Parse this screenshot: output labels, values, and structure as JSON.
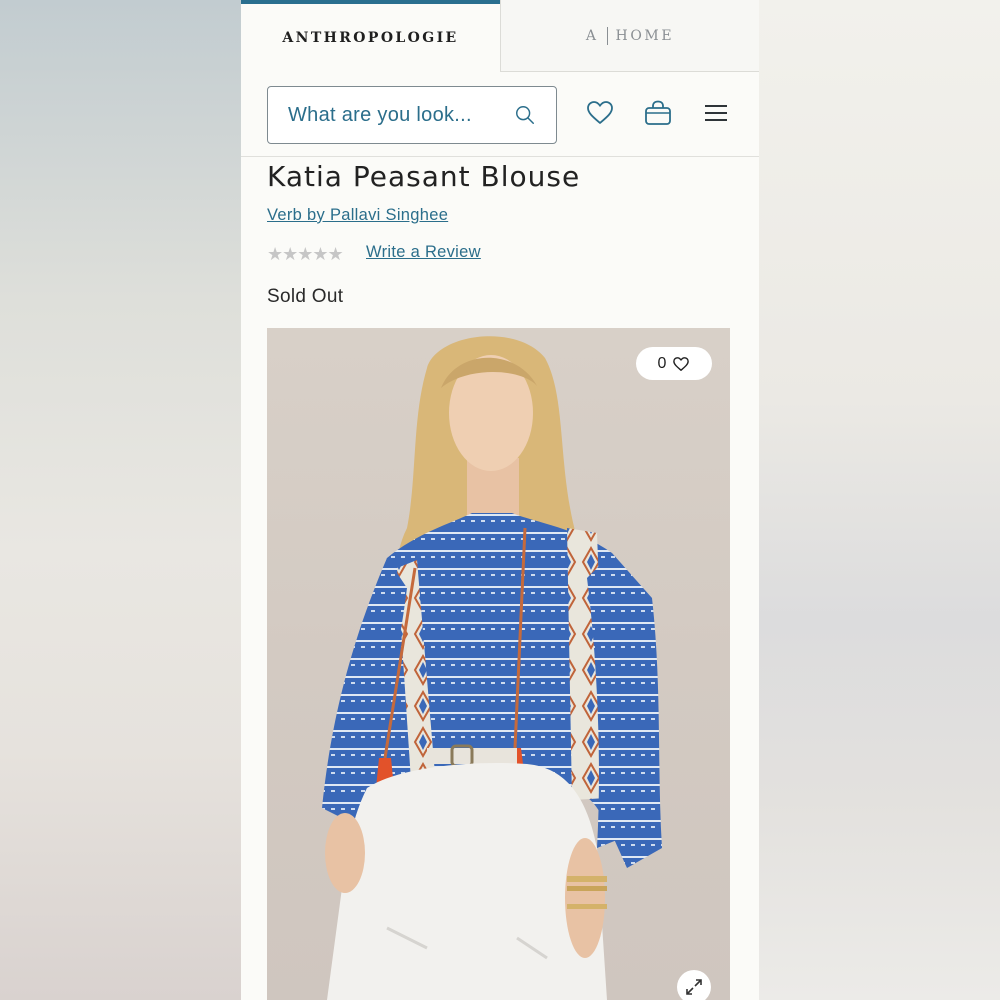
{
  "tabs": {
    "primary": "ANTHROPOLOGIE",
    "secondary_a": "A",
    "secondary_home": "HOME"
  },
  "header": {
    "search_placeholder": "What are you look...",
    "icons": [
      "heart-icon",
      "bag-icon",
      "menu-icon"
    ]
  },
  "product": {
    "title": "Katia Peasant Blouse",
    "brand": "Verb by Pallavi Singhee",
    "rating_stars": "★★★★★",
    "rating_value": 0,
    "review_link": "Write a Review",
    "availability": "Sold Out",
    "like_count": "0"
  },
  "colors": {
    "accent": "#2b6e8b",
    "tab_border": "#2a6f8f",
    "star_empty": "#c6c6c6",
    "blouse": "#3a68b8",
    "tassel": "#e2522a"
  }
}
